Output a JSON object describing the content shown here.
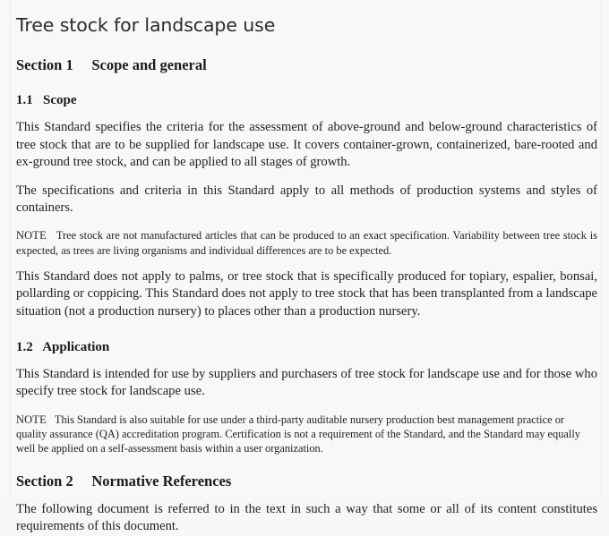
{
  "document": {
    "title": "Tree stock for landscape use",
    "sections": [
      {
        "heading_number": "Section 1",
        "heading_title": "Scope and general",
        "subsections": [
          {
            "number": "1.1",
            "title": "Scope",
            "paragraphs": [
              "This Standard specifies the criteria for the assessment of above-ground and below-ground characteristics of tree stock that are to be supplied for landscape use. It covers container-grown, containerized, bare-rooted and ex-ground tree stock, and can be applied to all stages of growth.",
              "The specifications and criteria in this Standard apply to all methods of production systems and styles of containers."
            ],
            "note_label": "NOTE",
            "note_text": "Tree stock are not manufactured articles that can be produced to an exact specification. Variability between tree stock is expected, as trees are living organisms and individual differences are to be expected.",
            "paragraphs_after_note": [
              "This Standard does not apply to palms, or tree stock that is specifically produced for topiary, espalier, bonsai, pollarding or coppicing. This Standard does not apply to tree stock that has been transplanted from a landscape situation (not a production nursery) to places other than a production nursery."
            ]
          },
          {
            "number": "1.2",
            "title": "Application",
            "paragraphs": [
              "This Standard is intended for use by suppliers and purchasers of tree stock for landscape use and for those who specify tree stock for landscape use."
            ],
            "note_label": "NOTE",
            "note_text": "This Standard is also suitable for use under a third-party auditable nursery production best management practice or quality assurance (QA) accreditation program. Certification is not a requirement of the Standard, and the Standard may equally well be applied on a self-assessment basis within a user organization."
          }
        ]
      },
      {
        "heading_number": "Section 2",
        "heading_title": "Normative References",
        "paragraphs": [
          "The following document is referred to in the text in such a way that some or all of its content constitutes requirements of this document."
        ]
      }
    ]
  },
  "colors": {
    "page_background": "#f8f8f8",
    "text": "#231f20",
    "heading": "#1a1a1a",
    "rule": "#ececec"
  }
}
